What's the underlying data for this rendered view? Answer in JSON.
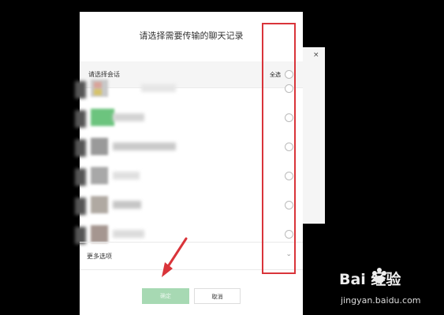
{
  "dialog": {
    "title": "请选择需要传输的聊天记录",
    "list_header": "请选择会话",
    "select_all_label": "全选",
    "more_options_label": "更多选项",
    "confirm_label": "确定",
    "cancel_label": "取消"
  },
  "background_window": {
    "close_glyph": "×"
  },
  "watermark": {
    "brand_text": "Bai  经验",
    "url_text": "jingyan.baidu.com"
  },
  "colors": {
    "highlight_box": "#d9343a",
    "confirm_disabled": "#a7d9b3",
    "backdrop": "#000000"
  }
}
